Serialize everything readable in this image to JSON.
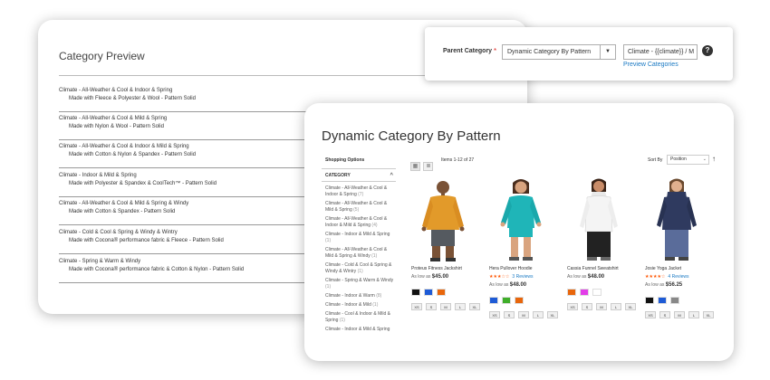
{
  "preview": {
    "title": "Category Preview",
    "items": [
      {
        "line1": "Climate - All-Weather & Cool & Indoor & Spring",
        "line2": "Made with Fleece & Polyester & Wool - Pattern Solid"
      },
      {
        "line1": "Climate - All-Weather & Cool & Mild & Spring",
        "line2": "Made with Nylon & Wool - Pattern Solid"
      },
      {
        "line1": "Climate - All-Weather & Cool & Indoor & Mild & Spring",
        "line2": "Made with Cotton & Nylon & Spandex - Pattern Solid"
      },
      {
        "line1": "Climate - Indoor & Mild & Spring",
        "line2": "Made with Polyester & Spandex & CoolTech™ - Pattern Solid"
      },
      {
        "line1": "Climate - All-Weather & Cool & Mild & Spring & Windy",
        "line2": "Made with Cotton & Spandex - Pattern Solid"
      },
      {
        "line1": "Climate - Cold & Cool & Spring & Windy & Wintry",
        "line2": "Made with Cocona® performance fabric & Fleece - Pattern Solid"
      },
      {
        "line1": "Climate - Spring & Warm & Windy",
        "line2": "Made with Cocona® performance fabric & Cotton & Nylon - Pattern Solid"
      }
    ]
  },
  "form": {
    "label": "Parent Category",
    "required_mark": "*",
    "select_value": "Dynamic Category By Pattern",
    "select_arrow": "▼",
    "input_value": "Climate - {{climate}} / M",
    "help": "?",
    "preview_link": "Preview Categories"
  },
  "store": {
    "title": "Dynamic Category By Pattern",
    "shopping_options": "Shopping Options",
    "category_heading": "CATEGORY",
    "category_chevron": "^",
    "categories": [
      {
        "name": "Climate - All-Weather & Cool & Indoor & Spring",
        "count": "(7)"
      },
      {
        "name": "Climate - All-Weather & Cool & Mild & Spring",
        "count": "(5)"
      },
      {
        "name": "Climate - All-Weather & Cool & Indoor & Mild & Spring",
        "count": "(4)"
      },
      {
        "name": "Climate - Indoor & Mild & Spring",
        "count": "(1)"
      },
      {
        "name": "Climate - All-Weather & Cool & Mild & Spring & Windy",
        "count": "(1)"
      },
      {
        "name": "Climate - Cold & Cool & Spring & Windy & Wintry",
        "count": "(1)"
      },
      {
        "name": "Climate - Spring & Warm & Windy",
        "count": "(1)"
      },
      {
        "name": "Climate - Indoor & Warm",
        "count": "(8)"
      },
      {
        "name": "Climate - Indoor & Mild",
        "count": "(1)"
      },
      {
        "name": "Climate - Cool & Indoor & Mild & Spring",
        "count": "(1)"
      },
      {
        "name": "Climate - Indoor & Mild & Spring",
        "count": ""
      }
    ],
    "view_modes": [
      "▦",
      "≣"
    ],
    "items_count": "Items 1-12 of 27",
    "sort_label": "Sort By",
    "sort_value": "Position",
    "sort_arrow": "⌄",
    "sort_direction": "↑",
    "products": [
      {
        "name": "Proteus Fitness Jackshirt",
        "stars": "",
        "reviews": "",
        "price_prefix": "As low as",
        "price": "$45.00",
        "colors": [
          "#111111",
          "#1e5bd6",
          "#e8660c"
        ],
        "sizes": [
          "XS",
          "S",
          "M",
          "L",
          "XL"
        ]
      },
      {
        "name": "Hera Pullover Hoodie",
        "stars": "★★★☆☆",
        "reviews": "3 Reviews",
        "price_prefix": "As low as",
        "price": "$48.00",
        "colors": [
          "#1e5bd6",
          "#3fae2a",
          "#e8660c"
        ],
        "sizes": [
          "XS",
          "S",
          "M",
          "L",
          "XL"
        ]
      },
      {
        "name": "Cassia Funnel Sweatshirt",
        "stars": "",
        "reviews": "",
        "price_prefix": "As low as",
        "price": "$48.00",
        "colors": [
          "#e8660c",
          "#e23de8",
          "#ffffff"
        ],
        "sizes": [
          "XS",
          "S",
          "M",
          "L",
          "XL"
        ]
      },
      {
        "name": "Josie Yoga Jacket",
        "stars": "★★★★☆",
        "reviews": "4 Reviews",
        "price_prefix": "As low as",
        "price": "$56.25",
        "colors": [
          "#111111",
          "#1e5bd6",
          "#888888"
        ],
        "sizes": [
          "XS",
          "S",
          "M",
          "L",
          "XL"
        ]
      }
    ]
  }
}
